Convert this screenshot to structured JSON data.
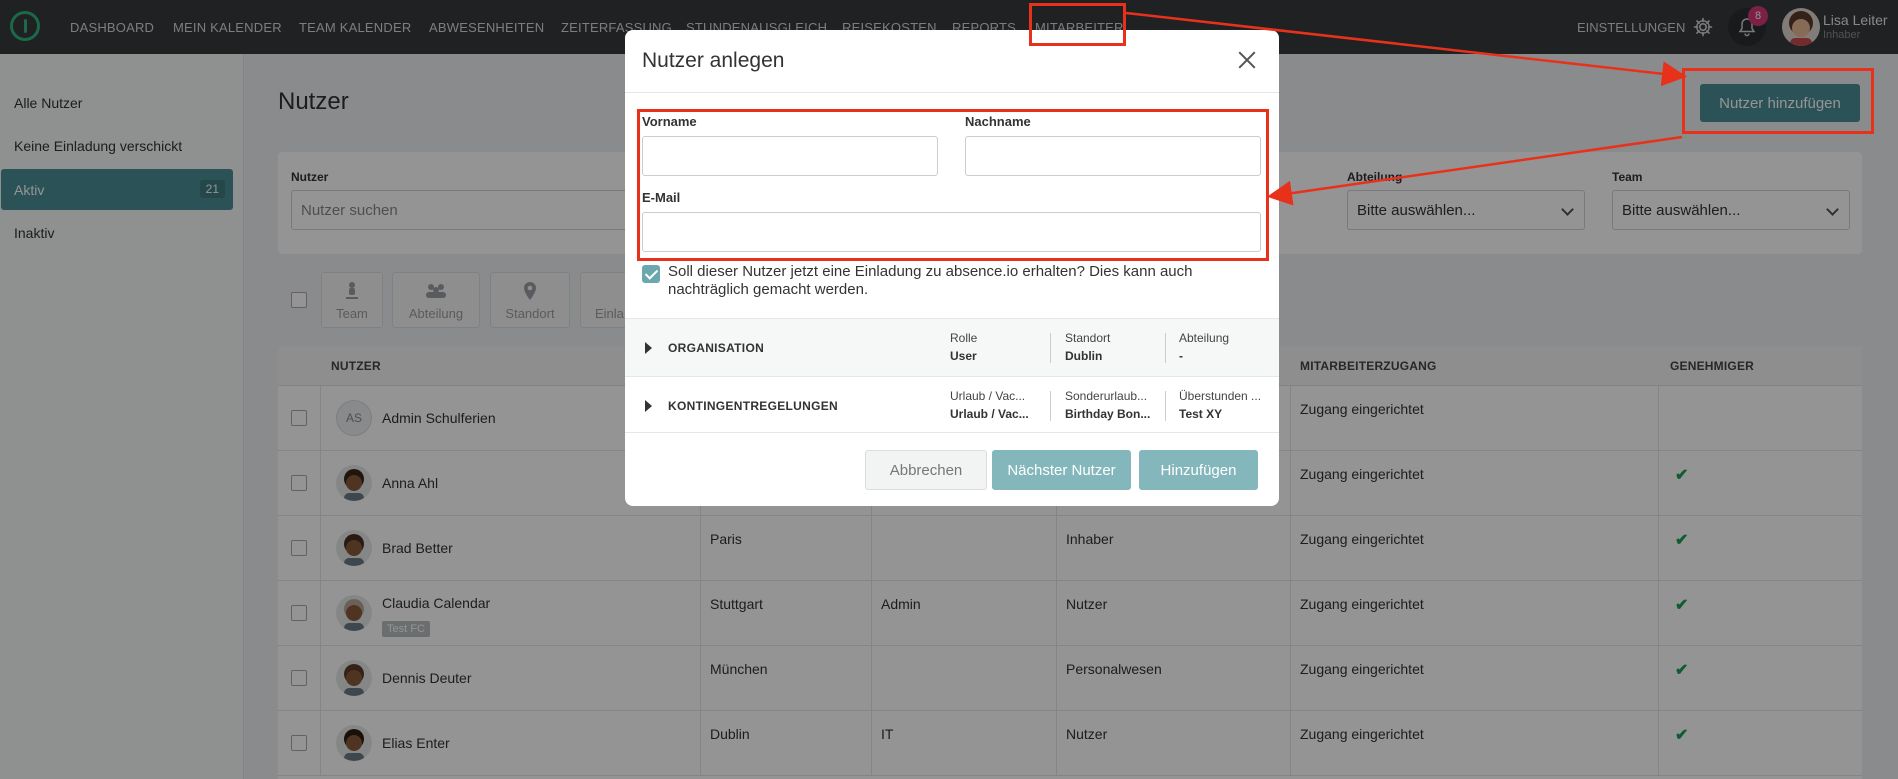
{
  "nav": {
    "items": [
      "DASHBOARD",
      "MEIN KALENDER",
      "TEAM KALENDER",
      "ABWESENHEITEN",
      "ZEITERFASSUNG",
      "STUNDENAUSGLEICH",
      "REISEKOSTEN",
      "REPORTS",
      "MITARBEITER"
    ],
    "settings_label": "EINSTELLUNGEN",
    "notification_count": "8",
    "user_name": "Lisa Leiter",
    "user_role": "Inhaber"
  },
  "sidebar": {
    "items": [
      "Alle Nutzer",
      "Keine Einladung verschickt",
      "Aktiv",
      "Inaktiv"
    ],
    "active_count": "21"
  },
  "page": {
    "title": "Nutzer",
    "add_button": "Nutzer hinzufügen"
  },
  "filters": {
    "user_label": "Nutzer",
    "user_placeholder": "Nutzer suchen",
    "department_label": "Abteilung",
    "department_value": "Bitte auswählen...",
    "team_label": "Team",
    "team_value": "Bitte auswählen..."
  },
  "toolbar": [
    "Team",
    "Abteilung",
    "Standort",
    "Einla"
  ],
  "table": {
    "headers": [
      "NUTZER",
      "MITARBEITERZUGANG",
      "GENEHMIGER"
    ],
    "rows": [
      {
        "initials": "AS",
        "name": "Admin Schulferien",
        "location": "",
        "department": "",
        "role": "",
        "access": "Zugang eingerichtet",
        "approver": false,
        "tag": ""
      },
      {
        "initials": "",
        "name": "Anna Ahl",
        "location": "",
        "department": "",
        "role": "",
        "access": "Zugang eingerichtet",
        "approver": true,
        "tag": ""
      },
      {
        "initials": "",
        "name": "Brad Better",
        "location": "Paris",
        "department": "",
        "role": "Inhaber",
        "access": "Zugang eingerichtet",
        "approver": true,
        "tag": ""
      },
      {
        "initials": "",
        "name": "Claudia Calendar",
        "location": "Stuttgart",
        "department": "Admin",
        "role": "Nutzer",
        "access": "Zugang eingerichtet",
        "approver": true,
        "tag": "Test FC"
      },
      {
        "initials": "",
        "name": "Dennis Deuter",
        "location": "München",
        "department": "",
        "role": "Personalwesen",
        "access": "Zugang eingerichtet",
        "approver": true,
        "tag": ""
      },
      {
        "initials": "",
        "name": "Elias Enter",
        "location": "Dublin",
        "department": "IT",
        "role": "Nutzer",
        "access": "Zugang eingerichtet",
        "approver": true,
        "tag": ""
      }
    ]
  },
  "modal": {
    "title": "Nutzer anlegen",
    "firstname_label": "Vorname",
    "lastname_label": "Nachname",
    "email_label": "E-Mail",
    "invite_text": "Soll dieser Nutzer jetzt eine Einladung zu absence.io erhalten? Dies kann auch nachträglich gemacht werden.",
    "organisation": {
      "title": "ORGANISATION",
      "role_label": "Rolle",
      "role_value": "User",
      "location_label": "Standort",
      "location_value": "Dublin",
      "department_label": "Abteilung",
      "department_value": "-"
    },
    "quota": {
      "title": "KONTINGENTREGELUNGEN",
      "c1_label": "Urlaub / Vac...",
      "c1_value": "Urlaub / Vac...",
      "c2_label": "Sonderurlaub...",
      "c2_value": "Birthday Bon...",
      "c3_label": "Überstunden ...",
      "c3_value": "Test XY"
    },
    "cancel": "Abbrechen",
    "next": "Nächster Nutzer",
    "add": "Hinzufügen"
  },
  "colors": {
    "accent": "#4a8f96",
    "annotation": "#e8311b",
    "approve": "#1b9e57"
  }
}
